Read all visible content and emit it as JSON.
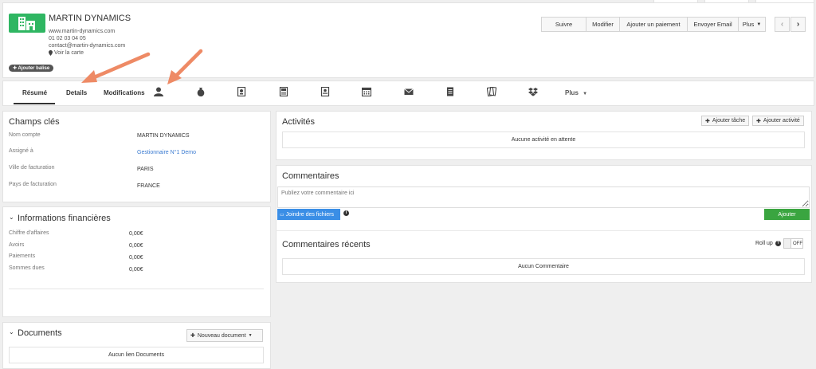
{
  "header": {
    "company_name": "MARTIN DYNAMICS",
    "website": "www.martin-dynamics.com",
    "phone": "01 02 03 04 05",
    "email": "contact@martin-dynamics.com",
    "map_link": "Voir la carte",
    "tag_button": "Ajouter balise",
    "actions": [
      "Suivre",
      "Modifier",
      "Ajouter un paiement",
      "Envoyer Email",
      "Plus"
    ],
    "prev": "‹",
    "next": "›"
  },
  "tabs": {
    "resume": "Résumé",
    "details": "Details",
    "modifications": "Modifications",
    "more": "Plus"
  },
  "key_fields": {
    "title": "Champs clés",
    "rows": [
      {
        "label": "Nom compte",
        "value": "MARTIN DYNAMICS"
      },
      {
        "label": "Assigné à",
        "value": "Gestionnaire N°1 Demo"
      },
      {
        "label": "Ville de facturation",
        "value": "PARIS"
      },
      {
        "label": "Pays de facturation",
        "value": "FRANCE"
      }
    ]
  },
  "financial": {
    "title": "Informations financières",
    "rows": [
      {
        "label": "Chiffre d'affaires",
        "value": "0,00€"
      },
      {
        "label": "Avoirs",
        "value": "0,00€"
      },
      {
        "label": "Paiements",
        "value": "0,00€"
      },
      {
        "label": "Sommes dues",
        "value": "0,00€"
      }
    ]
  },
  "documents": {
    "title": "Documents",
    "new_button": "Nouveau document",
    "empty": "Aucun lien Documents"
  },
  "activities": {
    "title": "Activités",
    "add_task": "Ajouter tâche",
    "add_activity": "Ajouter activité",
    "empty": "Aucune activité en attente"
  },
  "comments": {
    "title": "Commentaires",
    "placeholder": "Publiez votre commentaire ici",
    "attach_button": "Joindre des fichiers",
    "add_button": "Ajouter"
  },
  "recent_comments": {
    "title": "Commentaires récents",
    "rollup_label": "Roll up",
    "toggle_state": "OFF",
    "empty": "Aucun Commentaire"
  },
  "colors": {
    "brand_green": "#2fb662",
    "link_blue": "#3b7bd1",
    "attach_blue": "#3a8ee6",
    "add_green": "#3aa540",
    "arrow": "#ee8a65"
  }
}
